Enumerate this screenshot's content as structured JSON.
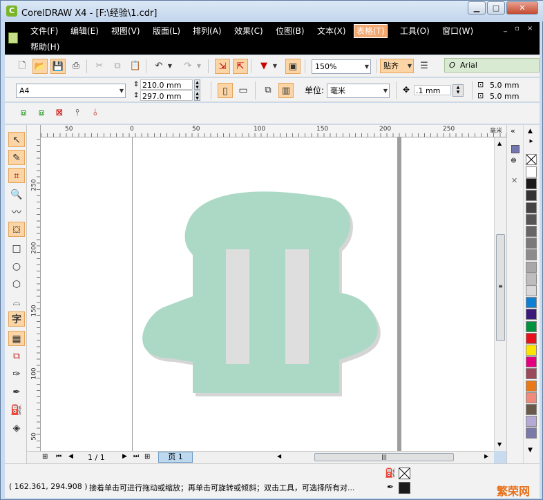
{
  "window": {
    "title": "CorelDRAW X4 - [F:\\经验\\1.cdr]",
    "app_icon": "coreldraw-icon"
  },
  "window_controls": {
    "minimize": "▁",
    "maximize": "□",
    "close": "✕"
  },
  "menu": {
    "items": [
      "文件(F)",
      "编辑(E)",
      "视图(V)",
      "版面(L)",
      "排列(A)",
      "效果(C)",
      "位图(B)",
      "文本(X)",
      "表格(T)",
      "工具(O)",
      "窗口(W)",
      "帮助(H)"
    ],
    "active": "表格(T)",
    "mdi": [
      "_",
      "▫",
      "×"
    ]
  },
  "standard_toolbar": {
    "zoom": "150%",
    "snap": "贴齐",
    "font": "Arial"
  },
  "property_bar": {
    "paper_size": "A4",
    "width": "210.0 mm",
    "height": "297.0 mm",
    "units_label": "单位:",
    "units": "毫米",
    "nudge": ".1 mm",
    "dup_x": "5.0 mm",
    "dup_y": "5.0 mm"
  },
  "ruler": {
    "unit_label": "毫米",
    "h_ticks": [
      "50",
      "0",
      "50",
      "100",
      "150",
      "200",
      "250"
    ],
    "v_ticks": [
      "250",
      "200",
      "150",
      "100",
      "50"
    ]
  },
  "page_nav": {
    "page_count": "1 / 1",
    "page_tab": "页 1"
  },
  "status": {
    "coords": "( 162.361, 294.908 )",
    "hint": "接着单击可进行拖动或缩放；再单击可旋转或倾斜；双击工具，可选择所有对...",
    "watermark": "繁荣网"
  },
  "colors": {
    "shape_fill": "#acd9c6",
    "shape_shadow": "#d5d5d5",
    "bars": "#dedede",
    "accent": "#f3a870"
  },
  "palette": [
    "#ffffff",
    "#1a1a1a",
    "#333333",
    "#444444",
    "#555555",
    "#666666",
    "#7a7a7a",
    "#8c8c8c",
    "#a8a8a8",
    "#bdbdbd",
    "#d9d9d9",
    "#0f7fd4",
    "#3b1a7a",
    "#00923f",
    "#e8101b",
    "#ffe400",
    "#e4007f",
    "#9b4a5a",
    "#e97818",
    "#f08a7a",
    "#6a5a4a",
    "#b5a9d6",
    "#7a7aa8"
  ]
}
